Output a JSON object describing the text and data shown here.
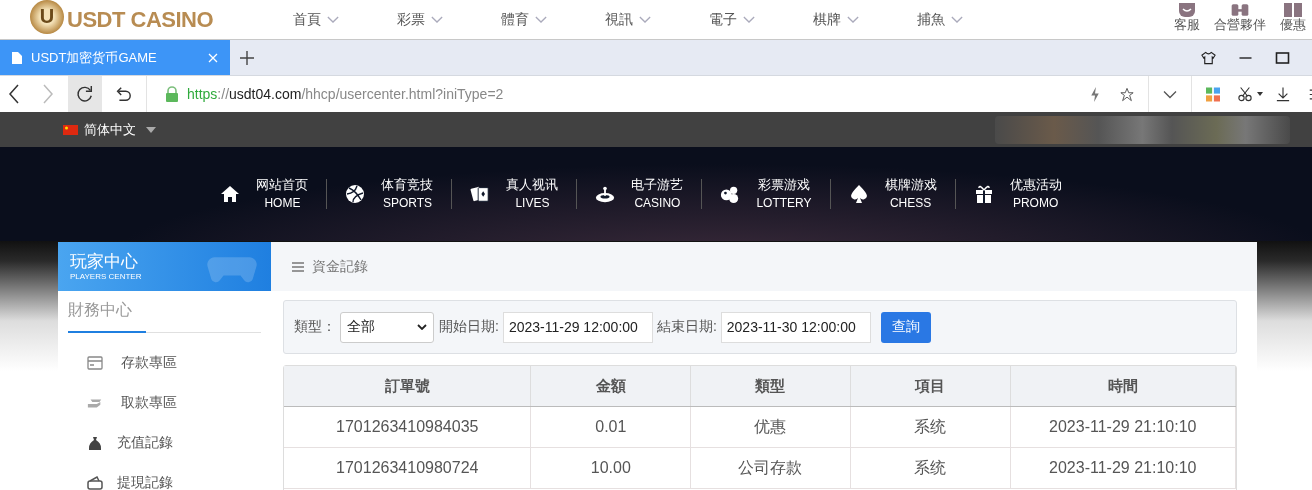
{
  "site_bar": {
    "logo_text": "USDT CASINO",
    "logo_letter": "U",
    "menu": [
      {
        "label": "首頁"
      },
      {
        "label": "彩票"
      },
      {
        "label": "體育"
      },
      {
        "label": "視訊"
      },
      {
        "label": "電子"
      },
      {
        "label": "棋牌"
      },
      {
        "label": "捕魚"
      }
    ],
    "shortcuts": [
      {
        "label": "客服"
      },
      {
        "label": "合營夥伴"
      },
      {
        "label": "優惠"
      }
    ]
  },
  "browser": {
    "tab": {
      "title": "USDT加密货币GAME",
      "selected": true
    },
    "url": [
      {
        "text": "https",
        "kind": "scheme"
      },
      {
        "text": "://",
        "kind": "muted"
      },
      {
        "text": "usdt04.com",
        "kind": "host"
      },
      {
        "text": "/hhcp/usercenter.html?iniType=2",
        "kind": "muted"
      }
    ]
  },
  "language_bar": {
    "language": "简体中文"
  },
  "main_nav": [
    {
      "zh": "网站首页",
      "en": "HOME"
    },
    {
      "zh": "体育竞技",
      "en": "SPORTS"
    },
    {
      "zh": "真人视讯",
      "en": "LIVES"
    },
    {
      "zh": "电子游艺",
      "en": "CASINO"
    },
    {
      "zh": "彩票游戏",
      "en": "LOTTERY"
    },
    {
      "zh": "棋牌游戏",
      "en": "CHESS"
    },
    {
      "zh": "优惠活动",
      "en": "PROMO"
    }
  ],
  "sidebar": {
    "title": "玩家中心",
    "subtitle": "PLAYERS CENTER",
    "section": "財務中心",
    "items": [
      {
        "label": "存款專區"
      },
      {
        "label": "取款專區"
      },
      {
        "label": "充值記錄"
      },
      {
        "label": "提現記錄"
      }
    ]
  },
  "panel": {
    "title": "資金記錄",
    "filter": {
      "type_label": "類型：",
      "type_value": "全部",
      "start_label": "開始日期:",
      "start_value": "2023-11-29 12:00:00",
      "end_label": "結束日期:",
      "end_value": "2023-11-30 12:00:00",
      "button": "查詢"
    },
    "table": {
      "columns": [
        "訂單號",
        "金額",
        "類型",
        "項目",
        "時間"
      ],
      "rows": [
        [
          "1701263410984035",
          "0.01",
          "优惠",
          "系统",
          "2023-11-29 21:10:10"
        ],
        [
          "1701263410980724",
          "10.00",
          "公司存款",
          "系统",
          "2023-11-29 21:10:10"
        ]
      ]
    }
  }
}
